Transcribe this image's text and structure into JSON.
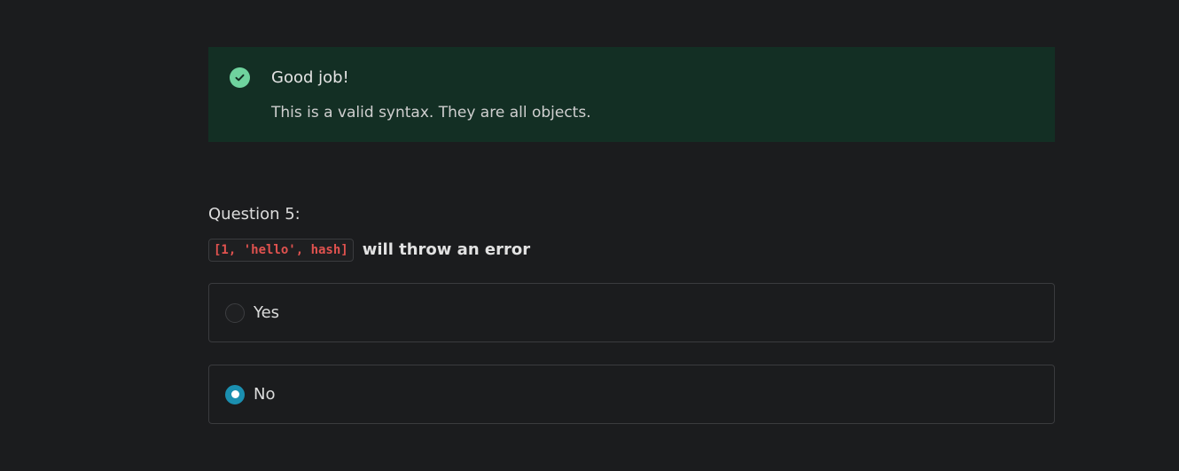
{
  "feedback": {
    "icon": "check-circle-icon",
    "title": "Good job!",
    "message": "This is a valid syntax. They are all objects.",
    "colors": {
      "background": "#132f24",
      "icon": "#6fd39e"
    }
  },
  "question": {
    "label": "Question 5:",
    "code": "[1, 'hello', hash]",
    "statement": "will throw an error"
  },
  "options": [
    {
      "label": "Yes",
      "selected": false
    },
    {
      "label": "No",
      "selected": true
    }
  ],
  "colors": {
    "accent": "#1b8fb0",
    "code_text": "#e0524f",
    "page_background": "#1b1c1e"
  }
}
